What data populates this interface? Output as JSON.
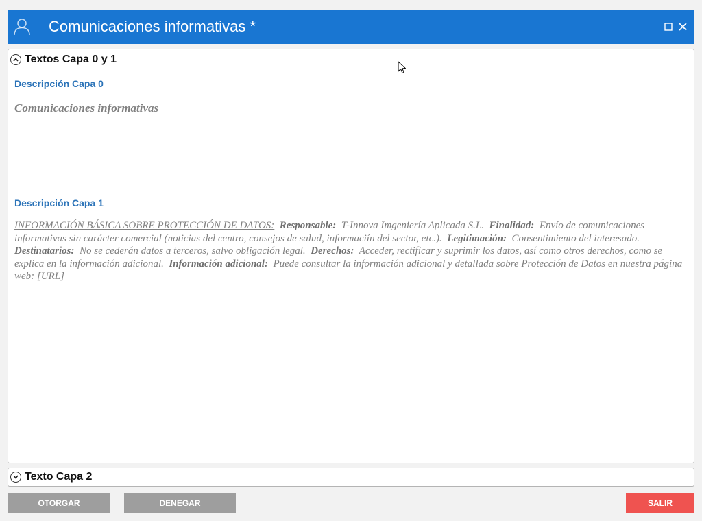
{
  "window": {
    "title": "Comunicaciones informativas *",
    "icons": {
      "user": "user-icon",
      "maximize": "maximize-icon",
      "close": "close-icon"
    },
    "accent_color": "#1976d2"
  },
  "section1": {
    "title": "Textos Capa 0 y 1",
    "state": "expanded",
    "icon": "chevron-up-icon",
    "layer0": {
      "label": "Descripción Capa 0",
      "text": "Comunicaciones informativas"
    },
    "layer1": {
      "label": "Descripción Capa 1",
      "heading": "INFORMACIÓN BÁSICA SOBRE PROTECCIÓN DE DATOS:",
      "parts": [
        {
          "term": "Responsable:",
          "value": "T-Innova Imgeniería Aplicada S.L."
        },
        {
          "term": "Finalidad:",
          "value": "Envío de comunicaciones informativas sin carácter comercial (noticias del centro, consejos de salud, informaciín del sector, etc.)."
        },
        {
          "term": "Legitimación:",
          "value": "Consentimiento del interesado."
        },
        {
          "term": "Destinatarios:",
          "value": "No se cederán datos a terceros, salvo obligación legal."
        },
        {
          "term": "Derechos:",
          "value": "Acceder, rectificar y suprimir los datos, así como otros derechos, como se explica en la información adicional."
        },
        {
          "term": "Información adicional:",
          "value": "Puede consultar la información adicional y detallada sobre Protección de Datos en nuestra página web: [URL]"
        }
      ]
    }
  },
  "section2": {
    "title": "Texto Capa 2",
    "state": "collapsed",
    "icon": "chevron-down-icon"
  },
  "buttons": {
    "grant": "OTORGAR",
    "deny": "DENEGAR",
    "exit": "SALIR"
  },
  "colors": {
    "label_blue": "#2b73b8",
    "button_gray": "#9e9e9e",
    "button_red": "#ef5350"
  }
}
